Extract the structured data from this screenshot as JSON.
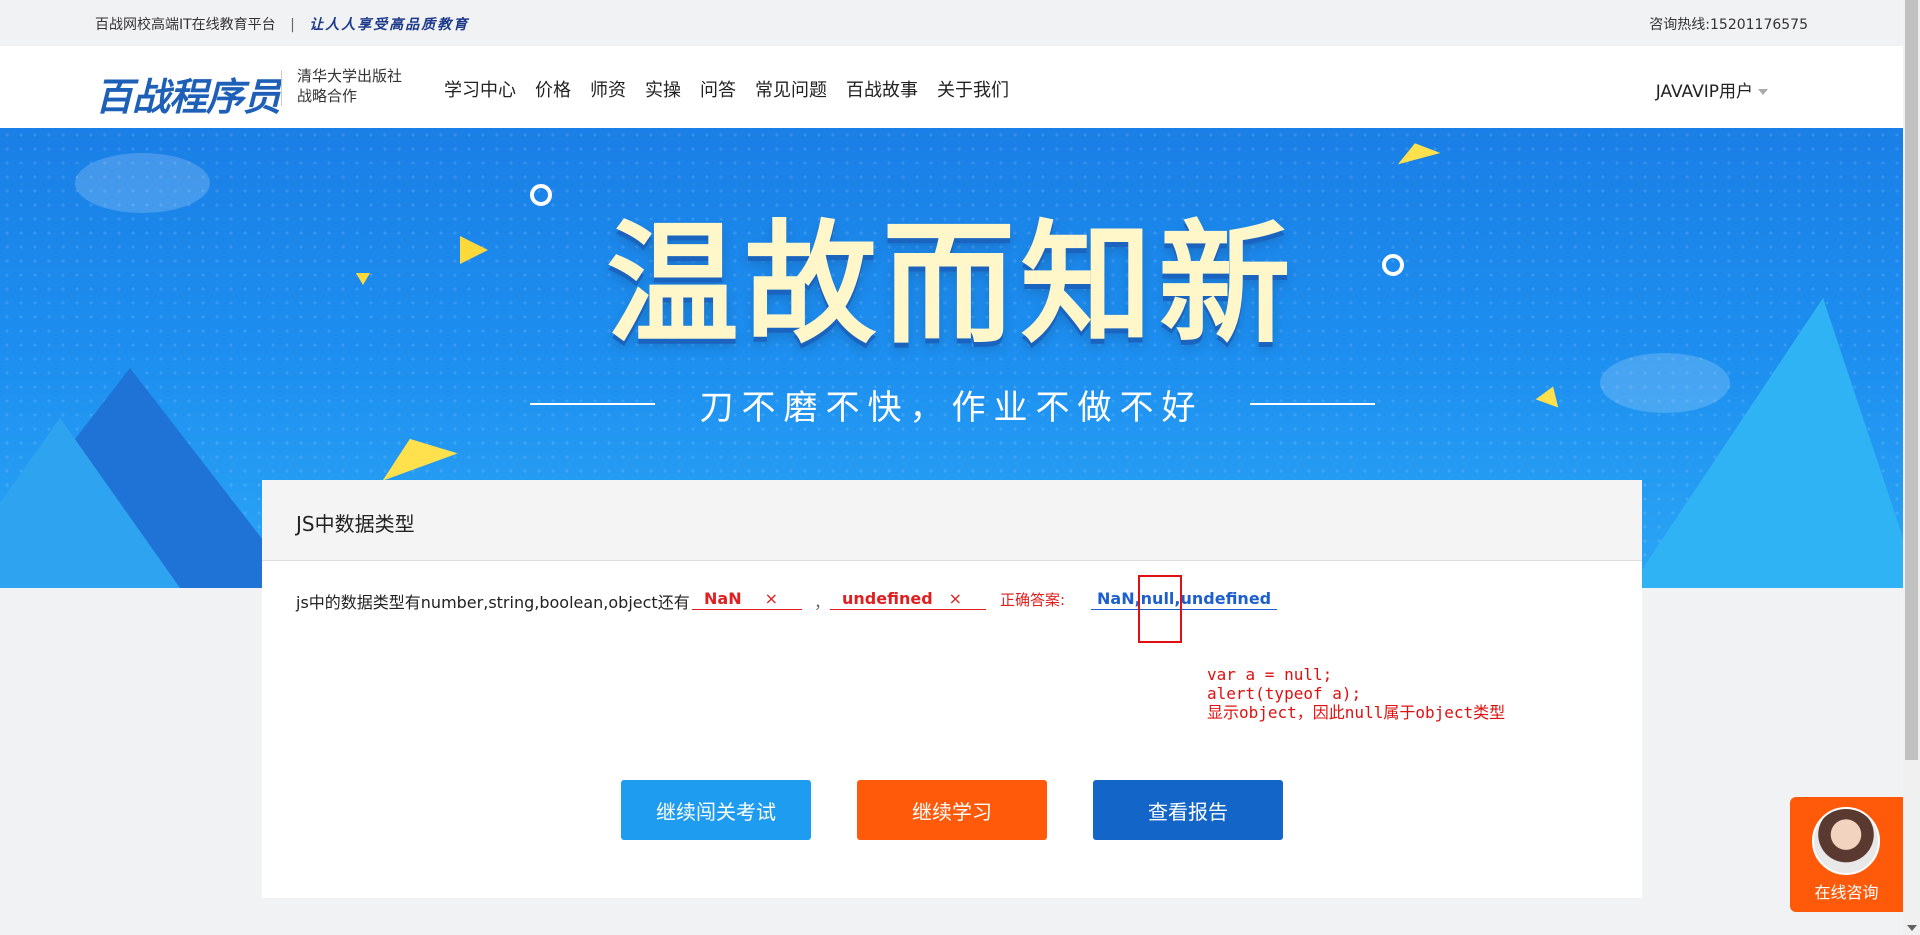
{
  "topbar": {
    "platform": "百战网校高端IT在线教育平台",
    "separator": "|",
    "slogan": "让人人享受高品质教育",
    "hotline": "咨询热线:15201176575"
  },
  "header": {
    "logo": "百战程序员",
    "partner_line1": "清华大学出版社",
    "partner_line2": "战略合作",
    "nav": [
      "学习中心",
      "价格",
      "师资",
      "实操",
      "问答",
      "常见问题",
      "百战故事",
      "关于我们"
    ],
    "user": "JAVAVIP用户"
  },
  "banner": {
    "title": "温故而知新",
    "subtitle": "刀不磨不快，作业不做不好"
  },
  "card": {
    "title": "JS中数据类型",
    "question": "js中的数据类型有number,string,boolean,object还有",
    "blank1": "NaN",
    "blank2": "undefined",
    "wrong_mark": "×",
    "comma": "，",
    "answer_label": "正确答案:",
    "answer": "NaN,null,undefined",
    "note_lines": [
      "var a = null;",
      "alert(typeof a);",
      "显示object，因此null属于object类型"
    ],
    "buttons": {
      "continue_exam": "继续闯关考试",
      "continue_study": "继续学习",
      "view_report": "查看报告"
    }
  },
  "consult": {
    "label": "在线咨询"
  },
  "colors": {
    "primary_blue": "#1e9cf0",
    "orange": "#ff5a0a",
    "dark_blue": "#1366c8",
    "error_red": "#e02020",
    "answer_blue": "#1e5fd0"
  }
}
